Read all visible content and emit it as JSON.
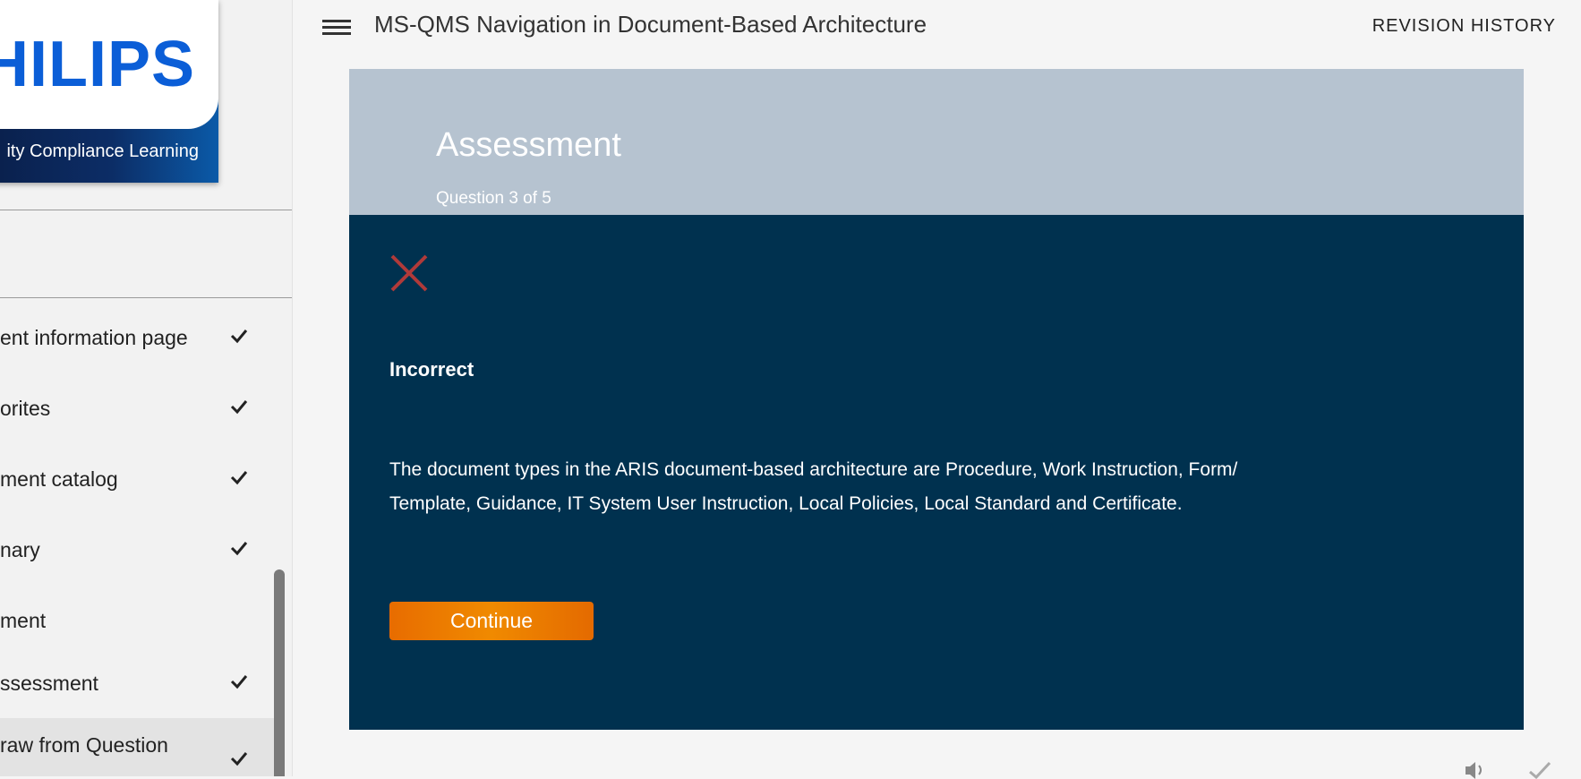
{
  "sidebar": {
    "logo": {
      "wordmark": "HILIPS",
      "subtitle": "ity Compliance Learning"
    },
    "items": [
      {
        "label": "ent information page",
        "checked": true
      },
      {
        "label": "orites",
        "checked": true
      },
      {
        "label": "ment catalog",
        "checked": true
      },
      {
        "label": "nary",
        "checked": true
      },
      {
        "label": "ment",
        "checked": false
      },
      {
        "label": "ssessment",
        "checked": true
      },
      {
        "label": "raw from Question",
        "checked": true
      }
    ]
  },
  "header": {
    "menu_icon": "hamburger-menu-icon",
    "title": "MS-QMS Navigation in Document-Based Architecture",
    "revision_history": "REVISION HISTORY"
  },
  "assessment": {
    "title": "Assessment",
    "progress": "Question 3 of 5",
    "result_icon": "incorrect-x-icon",
    "result": "Incorrect",
    "feedback_line1": "The document types in the ARIS document-based architecture are Procedure, Work Instruction, Form/",
    "feedback_line2": "Template, Guidance, IT System User Instruction, Local Policies, Local Standard and Certificate.",
    "continue_label": "Continue"
  },
  "colors": {
    "header_band": "#b6c3d0",
    "panel_bg": "#00314f",
    "incorrect_red": "#b03a3a",
    "continue_orange": "#f08a00"
  }
}
